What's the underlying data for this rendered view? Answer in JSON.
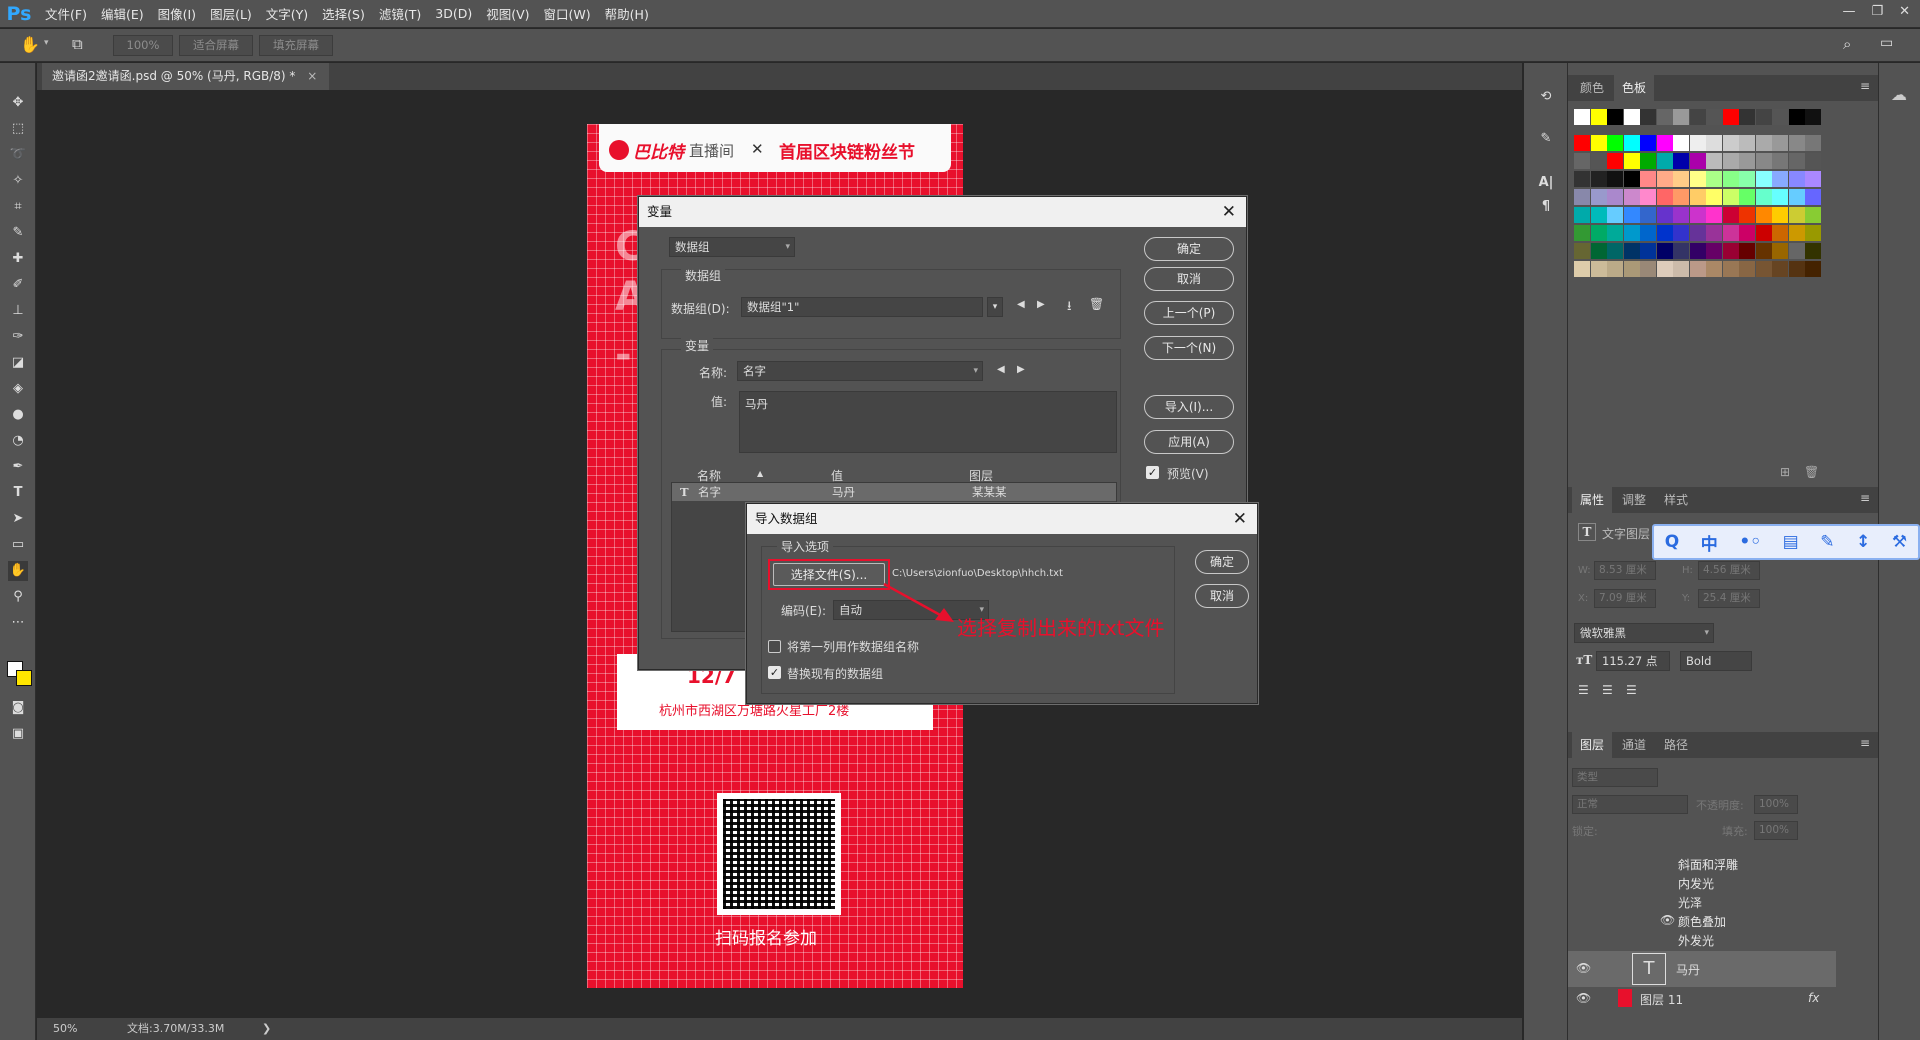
{
  "app": {
    "logo": "Ps",
    "menu": [
      "文件(F)",
      "编辑(E)",
      "图像(I)",
      "图层(L)",
      "文字(Y)",
      "选择(S)",
      "滤镜(T)",
      "3D(D)",
      "视图(V)",
      "窗口(W)",
      "帮助(H)"
    ],
    "window_controls": [
      "—",
      "❐",
      "✕"
    ]
  },
  "options_bar": {
    "zoom_btn": "100%",
    "fit_btn": "适合屏幕",
    "fill_btn": "填充屏幕"
  },
  "document": {
    "tab_title": "邀请函2邀请函.psd @ 50% (马丹, RGB/8) *",
    "tab_close": "×"
  },
  "status": {
    "zoom": "50%",
    "doc_size": "文档:3.70M/33.3M",
    "arrow": "❯"
  },
  "canvas": {
    "brand": "巴比特",
    "brand_sub": "直播间",
    "cross": "✕",
    "event": "首届区块链粉丝节",
    "letter_c": "C",
    "letter_a": "A",
    "dash": "-",
    "date_partial": "12/7",
    "address": "杭州市西湖区万塘路火星工厂2楼",
    "scan_text": "扫码报名参加"
  },
  "variables_dialog": {
    "title": "变量",
    "close": "✕",
    "mode_select": "数据组",
    "dataset_group_label": "数据组",
    "dataset_label": "数据组(D):",
    "dataset_value": "数据组\"1\"",
    "variables_group_label": "变量",
    "name_label": "名称:",
    "name_value": "名字",
    "value_label": "值:",
    "value_text": "马丹",
    "table_headers": [
      "名称",
      "值",
      "图层"
    ],
    "table_rows": [
      {
        "icon": "T",
        "name": "名字",
        "value": "马丹",
        "layer": "某某某"
      }
    ],
    "buttons": {
      "ok": "确定",
      "cancel": "取消",
      "prev": "上一个(P)",
      "next": "下一个(N)",
      "import": "导入(I)...",
      "apply": "应用(A)"
    },
    "preview_label": "预览(V)",
    "preview_checked": true
  },
  "import_dialog": {
    "title": "导入数据组",
    "close": "✕",
    "group_label": "导入选项",
    "select_file_btn": "选择文件(S)...",
    "file_path": "C:\\Users\\zionfuo\\Desktop\\hhch.txt",
    "encoding_label": "编码(E):",
    "encoding_value": "自动",
    "first_col_label": "将第一列用作数据组名称",
    "first_col_checked": false,
    "replace_label": "替换现有的数据组",
    "replace_checked": true,
    "ok": "确定",
    "cancel": "取消"
  },
  "annotation": {
    "text": "选择复制出来的txt文件",
    "color": "#e8102c"
  },
  "swatches_panel": {
    "tabs": [
      "颜色",
      "色板"
    ]
  },
  "properties_panel": {
    "tabs": [
      "属性",
      "调整",
      "样式"
    ],
    "type_label": "文字图层",
    "w_label": "W:",
    "w_value": "8.53 厘米",
    "h_label": "H:",
    "h_value": "4.56 厘米",
    "x_label": "X:",
    "x_value": "7.09 厘米",
    "y_label": "Y:",
    "y_value": "25.4 厘米",
    "font": "微软雅黑",
    "size": "115.27 点",
    "weight": "Bold"
  },
  "layers_panel": {
    "tabs": [
      "图层",
      "通道",
      "路径"
    ],
    "filter": "类型",
    "blend": "正常",
    "opacity_label": "不透明度:",
    "opacity_value": "100%",
    "lock_label": "锁定:",
    "fill_label": "填充:",
    "fill_value": "100%",
    "effects": [
      "斜面和浮雕",
      "内发光",
      "光泽",
      "颜色叠加",
      "外发光"
    ],
    "layers": [
      {
        "name": "马丹",
        "type": "T"
      },
      {
        "name": "图层 11",
        "type": "fx"
      }
    ]
  },
  "ime_toolbar": {
    "items": [
      "Q",
      "中",
      "•◦",
      "▤",
      "✎",
      "↕",
      "⚒"
    ]
  }
}
